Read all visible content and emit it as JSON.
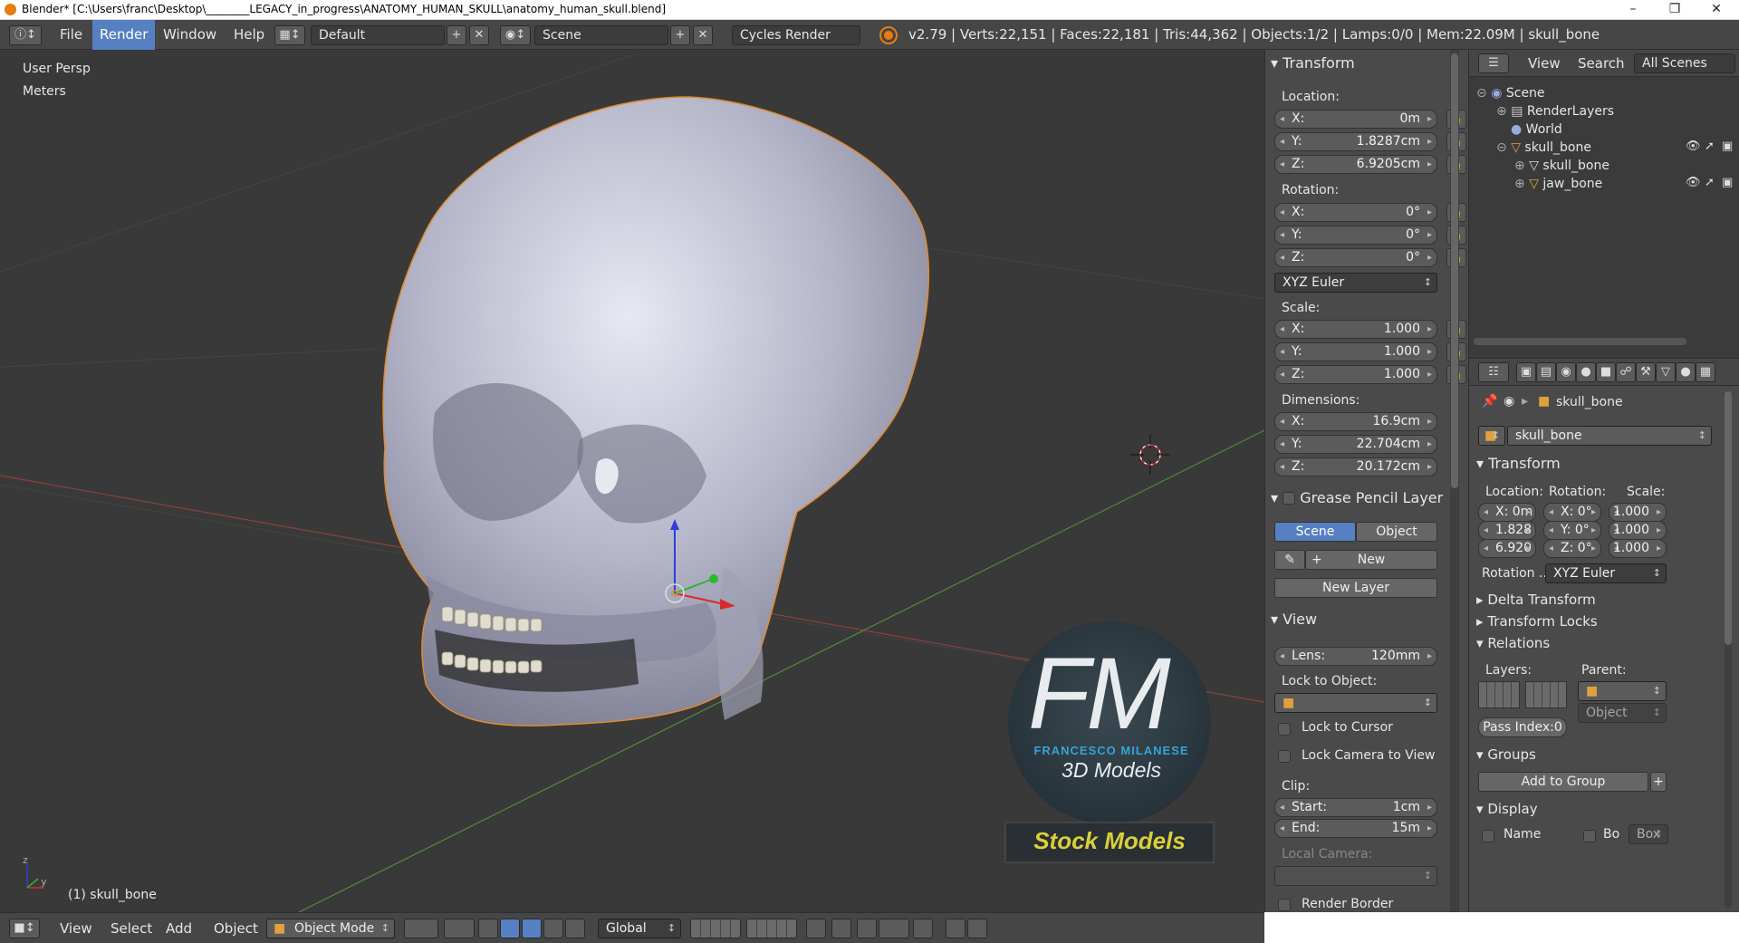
{
  "window": {
    "title": "Blender* [C:\\Users\\franc\\Desktop\\________LEGACY_in_progress\\ANATOMY_HUMAN_SKULL\\anatomy_human_skull.blend]",
    "minimize": "–",
    "maximize": "❐",
    "close": "✕"
  },
  "info_header": {
    "menus": [
      "File",
      "Render",
      "Window",
      "Help"
    ],
    "active_menu": "Render",
    "screen_layout": "Default",
    "scene": "Scene",
    "engine": "Cycles Render",
    "stats": "v2.79 | Verts:22,151 | Faces:22,181 | Tris:44,362 | Objects:1/2 | Lamps:0/0 | Mem:22.09M | skull_bone"
  },
  "viewport": {
    "view_name": "User Persp",
    "units": "Meters",
    "object_label": "(1) skull_bone"
  },
  "watermark": {
    "initials": "FM",
    "name": "FRANCESCO MILANESE",
    "sub": "3D Models",
    "tag": "Stock Models"
  },
  "npanel": {
    "transform": {
      "title": "Transform",
      "location_label": "Location:",
      "location": [
        {
          "k": "X:",
          "v": "0m"
        },
        {
          "k": "Y:",
          "v": "1.8287cm"
        },
        {
          "k": "Z:",
          "v": "6.9205cm"
        }
      ],
      "rotation_label": "Rotation:",
      "rotation": [
        {
          "k": "X:",
          "v": "0°"
        },
        {
          "k": "Y:",
          "v": "0°"
        },
        {
          "k": "Z:",
          "v": "0°"
        }
      ],
      "rotation_mode": "XYZ Euler",
      "scale_label": "Scale:",
      "scale": [
        {
          "k": "X:",
          "v": "1.000"
        },
        {
          "k": "Y:",
          "v": "1.000"
        },
        {
          "k": "Z:",
          "v": "1.000"
        }
      ],
      "dimensions_label": "Dimensions:",
      "dimensions": [
        {
          "k": "X:",
          "v": "16.9cm"
        },
        {
          "k": "Y:",
          "v": "22.704cm"
        },
        {
          "k": "Z:",
          "v": "20.172cm"
        }
      ]
    },
    "grease_pencil": {
      "title": "Grease Pencil Layer",
      "scene_btn": "Scene",
      "object_btn": "Object",
      "new_btn": "New",
      "new_layer_btn": "New Layer"
    },
    "view": {
      "title": "View",
      "lens_k": "Lens:",
      "lens_v": "120mm",
      "lock_obj": "Lock to Object:",
      "lock_cursor": "Lock to Cursor",
      "lock_camera": "Lock Camera to View",
      "clip": "Clip:",
      "start_k": "Start:",
      "start_v": "1cm",
      "end_k": "End:",
      "end_v": "15m",
      "local_camera": "Local Camera:",
      "render_border": "Render Border"
    }
  },
  "outliner": {
    "view": "View",
    "search": "Search",
    "filter": "All Scenes",
    "items": [
      {
        "label": "Scene",
        "indent": 0
      },
      {
        "label": "RenderLayers",
        "indent": 1
      },
      {
        "label": "World",
        "indent": 1
      },
      {
        "label": "skull_bone",
        "indent": 1
      },
      {
        "label": "skull_bone",
        "indent": 2
      },
      {
        "label": "jaw_bone",
        "indent": 2
      }
    ]
  },
  "properties": {
    "breadcrumb": "skull_bone",
    "object_name": "skull_bone",
    "transform_title": "Transform",
    "location_label": "Location:",
    "rotation_label": "Rotation:",
    "scale_label": "Scale:",
    "loc": [
      "X: 0m",
      "1.828",
      "6.920"
    ],
    "rot": [
      "X:  0°",
      "Y:  0°",
      "Z:  0°"
    ],
    "scl": [
      "1.000",
      "1.000",
      "1.000"
    ],
    "rotation_mode_label": "Rotation ...",
    "rotation_mode": "XYZ Euler",
    "delta": "Delta Transform",
    "locks": "Transform Locks",
    "relations": "Relations",
    "layers_label": "Layers:",
    "parent_label": "Parent:",
    "parent_type": "Object",
    "pass_index": "Pass Index:0",
    "groups": "Groups",
    "add_to_group": "Add to Group",
    "display": "Display",
    "name_chk": "Name",
    "bo_chk": "Bo",
    "box": "Box"
  },
  "bottom": {
    "menus": [
      "View",
      "Select",
      "Add",
      "Object"
    ],
    "mode": "Object Mode",
    "orientation": "Global"
  }
}
